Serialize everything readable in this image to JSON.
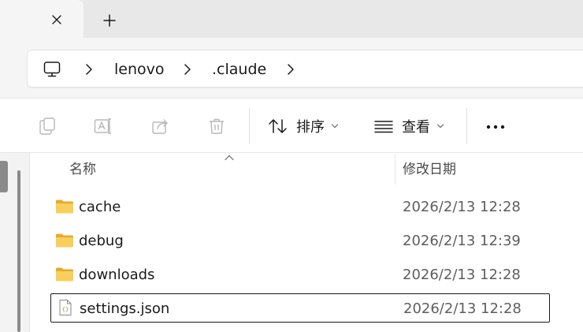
{
  "tab": {
    "close_icon": "close-icon",
    "new_tab_icon": "plus-icon"
  },
  "breadcrumb": {
    "root_icon": "this-pc-icon",
    "items": [
      "lenovo",
      ".claude"
    ]
  },
  "toolbar": {
    "copy_icon": "copy-icon",
    "rename_icon": "rename-icon",
    "share_icon": "share-icon",
    "delete_icon": "delete-icon",
    "sort_label": "排序",
    "view_label": "查看",
    "more_icon": "more-icon"
  },
  "columns": {
    "name": "名称",
    "date": "修改日期"
  },
  "files": [
    {
      "name": "cache",
      "date": "2026/2/13 12:28",
      "type": "folder"
    },
    {
      "name": "debug",
      "date": "2026/2/13 12:39",
      "type": "folder"
    },
    {
      "name": "downloads",
      "date": "2026/2/13 12:28",
      "type": "folder"
    },
    {
      "name": "settings.json",
      "date": "2026/2/13 12:28",
      "type": "json"
    }
  ],
  "colors": {
    "folder": "#f6c54b",
    "selection_border": "#1a1a1a",
    "tabstrip": "#e8e8e8"
  }
}
